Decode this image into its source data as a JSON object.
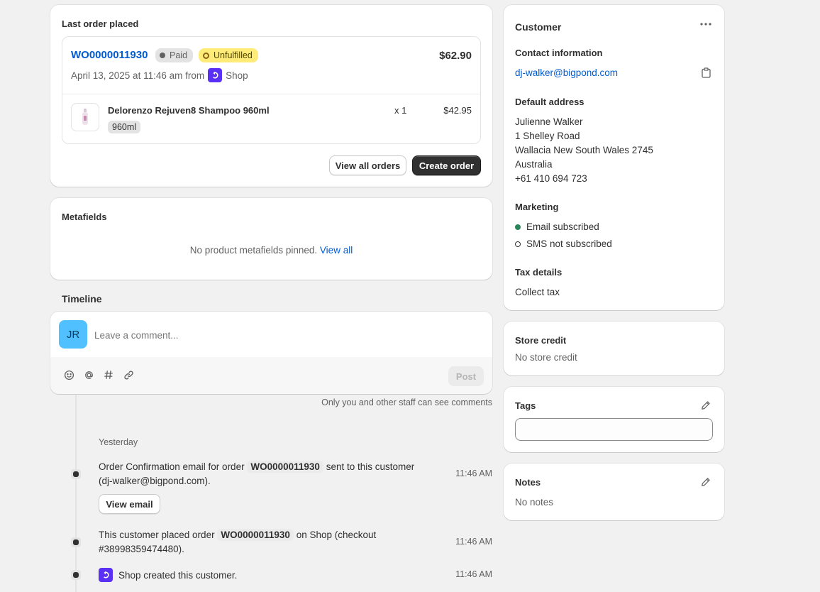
{
  "last_order": {
    "title": "Last order placed",
    "order_number": "WO0000011930",
    "paid_badge": "Paid",
    "unfulfilled_badge": "Unfulfilled",
    "total": "$62.90",
    "date_prefix": "April 13, 2025 at 11:46 am from",
    "channel": "Shop",
    "item": {
      "name": "Delorenzo Rejuven8 Shampoo 960ml",
      "variant": "960ml",
      "qty": "x 1",
      "price": "$42.95"
    },
    "view_all_label": "View all orders",
    "create_label": "Create order"
  },
  "metafields": {
    "title": "Metafields",
    "empty_text": "No product metafields pinned.",
    "view_all_label": "View all"
  },
  "timeline": {
    "title": "Timeline",
    "avatar_initials": "JR",
    "comment_placeholder": "Leave a comment...",
    "post_label": "Post",
    "staff_note": "Only you and other staff can see comments",
    "day_label": "Yesterday",
    "events": [
      {
        "text_before": "Order Confirmation email for order",
        "order": "WO0000011930",
        "text_after": "sent to this customer",
        "line2": "(dj-walker@bigpond.com).",
        "time": "11:46 AM",
        "button": "View email"
      },
      {
        "text_before": "This customer placed order",
        "order": "WO0000011930",
        "text_after": "on Shop (checkout",
        "line2": "#38998359474480).",
        "time": "11:46 AM"
      },
      {
        "text": "Shop created this customer.",
        "time": "11:46 AM"
      }
    ]
  },
  "customer": {
    "title": "Customer",
    "contact_heading": "Contact information",
    "email": "dj-walker@bigpond.com",
    "address_heading": "Default address",
    "address_lines": [
      "Julienne Walker",
      "1 Shelley Road",
      "Wallacia New South Wales 2745",
      "Australia",
      "+61 410 694 723"
    ],
    "marketing_heading": "Marketing",
    "email_status": "Email subscribed",
    "sms_status": "SMS not subscribed",
    "tax_heading": "Tax details",
    "tax_value": "Collect tax"
  },
  "store_credit": {
    "title": "Store credit",
    "value": "No store credit"
  },
  "tags": {
    "title": "Tags",
    "value": ""
  },
  "notes": {
    "title": "Notes",
    "value": "No notes"
  },
  "colors": {
    "link": "#005bd3",
    "subscribed": "#29845a",
    "shop": "#5a31f4",
    "avatar": "#51c0ff"
  }
}
